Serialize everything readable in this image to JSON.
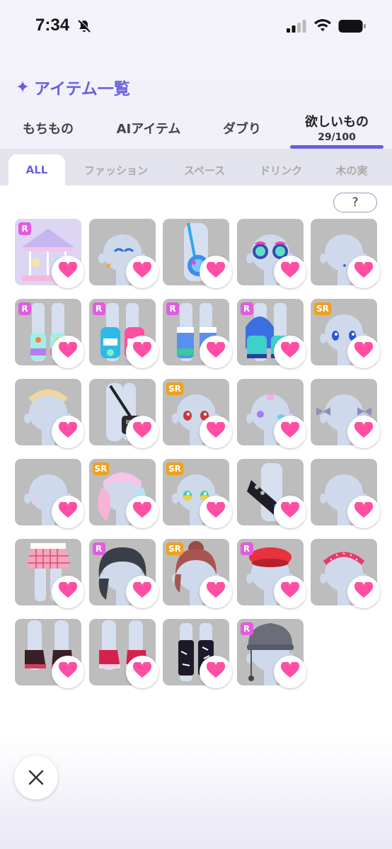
{
  "status_bar": {
    "time": "7:34"
  },
  "header": {
    "title": "アイテム一覧"
  },
  "tabs": [
    {
      "label": "もちもの"
    },
    {
      "label": "AIアイテム"
    },
    {
      "label": "ダブり"
    },
    {
      "label": "欲しいもの",
      "count": "29/100",
      "active": true
    }
  ],
  "filters": [
    {
      "label": "ALL",
      "active": true
    },
    {
      "label": "ファッション"
    },
    {
      "label": "スペース"
    },
    {
      "label": "ドリンク"
    },
    {
      "label": "木の実"
    }
  ],
  "help_label": "?",
  "accent_color": "#6a5fe0",
  "heart_color": "#ff4fa3",
  "items": [
    {
      "rarity": "R",
      "kind": "carousel"
    },
    {
      "rarity": "",
      "kind": "face-stars"
    },
    {
      "rarity": "",
      "kind": "bag-planet"
    },
    {
      "rarity": "",
      "kind": "glasses"
    },
    {
      "rarity": "",
      "kind": "face-dot"
    },
    {
      "rarity": "R",
      "kind": "boots-rainbow"
    },
    {
      "rarity": "R",
      "kind": "boots-bottles"
    },
    {
      "rarity": "R",
      "kind": "boots-blue"
    },
    {
      "rarity": "R",
      "kind": "heels-aqua"
    },
    {
      "rarity": "SR",
      "kind": "eyes-blue"
    },
    {
      "rarity": "",
      "kind": "headband-gold"
    },
    {
      "rarity": "",
      "kind": "bag-black"
    },
    {
      "rarity": "SR",
      "kind": "eyes-red"
    },
    {
      "rarity": "",
      "kind": "stickers"
    },
    {
      "rarity": "",
      "kind": "bows"
    },
    {
      "rarity": "",
      "kind": "blush"
    },
    {
      "rarity": "SR",
      "kind": "twintails"
    },
    {
      "rarity": "SR",
      "kind": "eyes-rainbow"
    },
    {
      "rarity": "",
      "kind": "bag-belt"
    },
    {
      "rarity": "",
      "kind": "earring"
    },
    {
      "rarity": "",
      "kind": "skirt-plaid"
    },
    {
      "rarity": "R",
      "kind": "hair-dark"
    },
    {
      "rarity": "SR",
      "kind": "hair-bun"
    },
    {
      "rarity": "R",
      "kind": "beret-red"
    },
    {
      "rarity": "",
      "kind": "headband-pink"
    },
    {
      "rarity": "",
      "kind": "cuffs-dark"
    },
    {
      "rarity": "",
      "kind": "cuffs-pink"
    },
    {
      "rarity": "",
      "kind": "legwarmers"
    },
    {
      "rarity": "R",
      "kind": "beanie"
    }
  ]
}
